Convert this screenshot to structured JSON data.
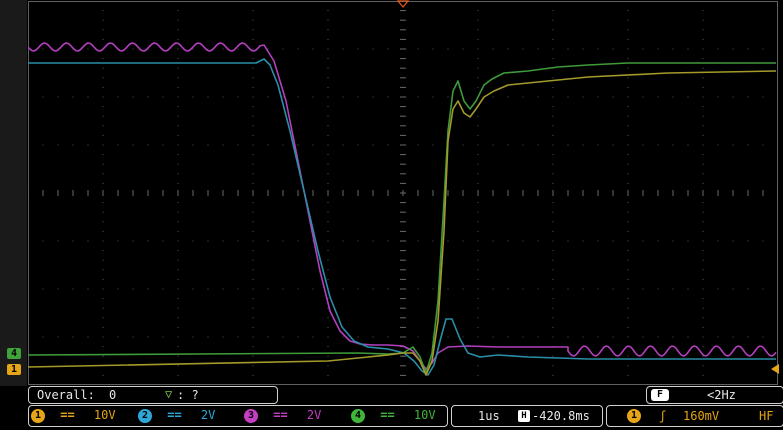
{
  "display": {
    "left_markers": {
      "ch4": "4",
      "ch1": "1"
    }
  },
  "status": {
    "overall_label": "Overall:",
    "overall_value": "0",
    "trigger_symbol": "▽",
    "trigger_value": ": ?",
    "freq_icon": "F",
    "freq_value": "<2Hz"
  },
  "channels": [
    {
      "badge": "1",
      "coupling": "==",
      "scale": "10V",
      "color": "#e6a417"
    },
    {
      "badge": "2",
      "coupling": "==",
      "scale": "2V",
      "color": "#2ea7d8"
    },
    {
      "badge": "3",
      "coupling": "==",
      "scale": "2V",
      "color": "#c53ec3"
    },
    {
      "badge": "4",
      "coupling": "==",
      "scale": "10V",
      "color": "#3fb53a"
    }
  ],
  "timebase": {
    "value": "1us",
    "hpos_icon": "H",
    "hpos_value": "-420.8ms"
  },
  "trigger": {
    "channel": "1",
    "slope_symbol": "ʃ",
    "level": "160mV",
    "coupling": "HF"
  },
  "trace_colors": {
    "ch1": "#a39a2a",
    "ch2": "#2b8ea8",
    "ch3": "#b43fbf",
    "ch4": "#3f9a3a"
  }
}
